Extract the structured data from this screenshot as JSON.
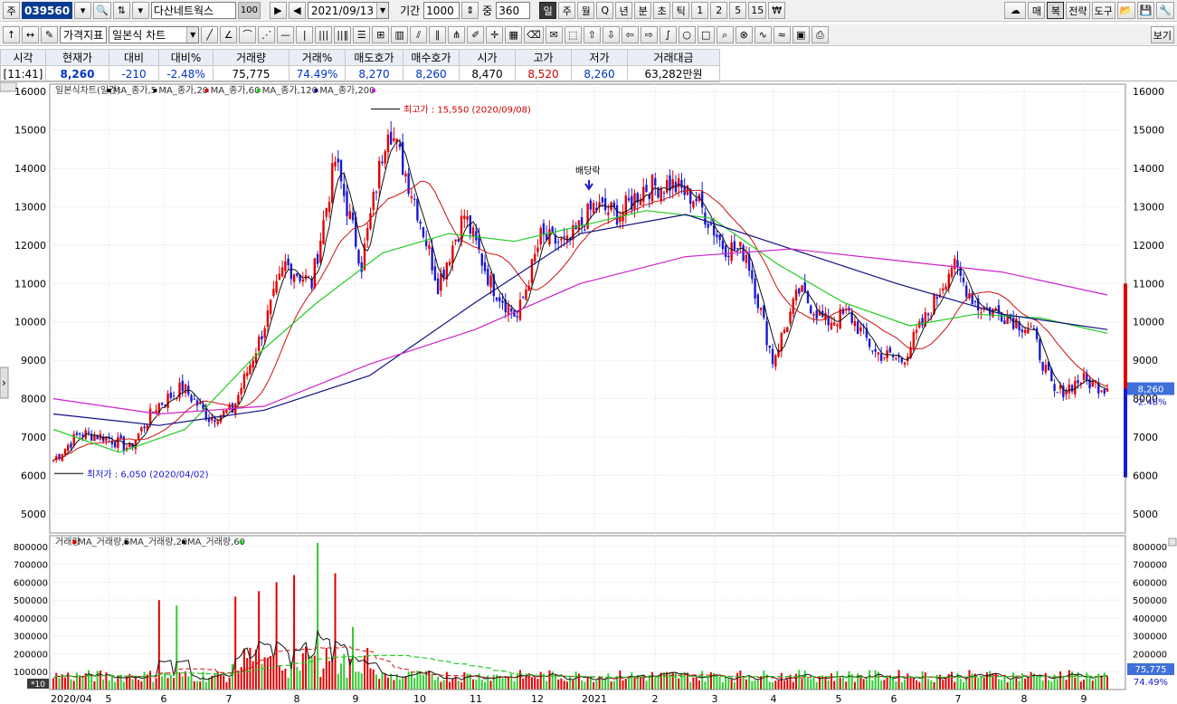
{
  "toolbar1": {
    "jong_label": "주",
    "code": "039560",
    "name": "다산네트웍스",
    "badge": "100",
    "date": "2021/09/13",
    "period_label": "기간",
    "period_value": "1000",
    "count_label": "중",
    "count_value": "360",
    "periods": [
      "일",
      "주",
      "월",
      "Q",
      "년",
      "분",
      "초",
      "틱",
      "1",
      "2",
      "5",
      "15",
      "₩"
    ],
    "right": [
      "매",
      "복",
      "전략",
      "도구"
    ]
  },
  "toolbar2": {
    "indicator_label": "가격지표",
    "chart_type": "일본식 차트",
    "view_label": "보기"
  },
  "quote": {
    "headers": [
      "시각",
      "현재가",
      "대비",
      "대비%",
      "거래량",
      "거래%",
      "매도호가",
      "매수호가",
      "시가",
      "고가",
      "저가",
      "거래대금"
    ],
    "time": "[11:41]",
    "price": "8,260",
    "change": "-210",
    "change_pct": "-2.48%",
    "volume": "75,775",
    "volume_pct": "74.49%",
    "ask": "8,270",
    "bid": "8,260",
    "open": "8,470",
    "high": "8,520",
    "low": "8,260",
    "amount": "63,282만원"
  },
  "price_legend": [
    "일본식차트(일간)",
    "MA_종가,5",
    "MA_종가,20",
    "MA_종가,60",
    "MA_종가,120",
    "MA_종가,200"
  ],
  "volume_legend": [
    "거래량",
    "MA_거래량,5",
    "MA_거래량,20",
    "MA_거래량,60"
  ],
  "annotations": {
    "max": "최고가 : 15,550 (2020/09/08)",
    "min": "최저가 : 6,050 (2020/04/02)",
    "dividend": "배당락",
    "price_tag": "8,260",
    "pct_tag": "-2.48%",
    "vol_tag": "75,775",
    "vol_pct_tag": "74.49%",
    "vol_unit": "*10"
  },
  "colors": {
    "up": "#e00000",
    "down": "#1a1ad0",
    "ma5": "#111111",
    "ma20": "#cc1111",
    "ma60": "#22cc22",
    "ma120": "#101080",
    "ma200": "#cc22cc"
  },
  "chart_data": [
    {
      "type": "candlestick",
      "title": "일본식차트(일간)",
      "ylim": [
        4500,
        16100
      ],
      "y_ticks": [
        5000,
        6000,
        7000,
        8000,
        9000,
        10000,
        11000,
        12000,
        13000,
        14000,
        15000,
        16000
      ],
      "x_ticks": [
        "2020/04",
        "5",
        "6",
        "7",
        "8",
        "9",
        "10",
        "11",
        "12",
        "2021",
        "2",
        "3",
        "4",
        "5",
        "6",
        "7",
        "8",
        "9"
      ],
      "close_path": [
        {
          "x": "2020/04",
          "close": 6400
        },
        {
          "x": "4 mid",
          "close": 7100
        },
        {
          "x": "5",
          "close": 7000
        },
        {
          "x": "5 mid",
          "close": 6700
        },
        {
          "x": "6",
          "close": 7800
        },
        {
          "x": "6 mid",
          "close": 8300
        },
        {
          "x": "6 late",
          "close": 7500
        },
        {
          "x": "7",
          "close": 7700
        },
        {
          "x": "7 mid",
          "close": 9500
        },
        {
          "x": "7 late",
          "close": 11500
        },
        {
          "x": "8",
          "close": 11000
        },
        {
          "x": "8 mid",
          "close": 14200
        },
        {
          "x": "8 late",
          "close": 11500
        },
        {
          "x": "9",
          "close": 15200
        },
        {
          "x": "9 mid",
          "close": 13200
        },
        {
          "x": "9 late",
          "close": 11000
        },
        {
          "x": "10",
          "close": 12800
        },
        {
          "x": "10 mid",
          "close": 11000
        },
        {
          "x": "10 late",
          "close": 10100
        },
        {
          "x": "11",
          "close": 12200
        },
        {
          "x": "11 mid",
          "close": 12000
        },
        {
          "x": "12",
          "close": 13000
        },
        {
          "x": "12 mid",
          "close": 12800
        },
        {
          "x": "12 late",
          "close": 13500
        },
        {
          "x": "2021",
          "close": 13600
        },
        {
          "x": "1 mid",
          "close": 13200
        },
        {
          "x": "2",
          "close": 12000
        },
        {
          "x": "2 mid",
          "close": 11800
        },
        {
          "x": "3",
          "close": 9000
        },
        {
          "x": "3 mid",
          "close": 10800
        },
        {
          "x": "4",
          "close": 10000
        },
        {
          "x": "4 mid",
          "close": 10200
        },
        {
          "x": "5",
          "close": 9200
        },
        {
          "x": "5 mid",
          "close": 9000
        },
        {
          "x": "6",
          "close": 10200
        },
        {
          "x": "6 mid",
          "close": 11500
        },
        {
          "x": "7",
          "close": 10400
        },
        {
          "x": "7 mid",
          "close": 10200
        },
        {
          "x": "8",
          "close": 9800
        },
        {
          "x": "8 mid",
          "close": 8100
        },
        {
          "x": "9",
          "close": 8500
        },
        {
          "x": "9 current",
          "close": 8260
        }
      ],
      "ma_values": {
        "MA_종가,60": [
          {
            "x": "2020/04",
            "v": 7200
          },
          {
            "x": "5",
            "v": 6600
          },
          {
            "x": "7",
            "v": 7200
          },
          {
            "x": "8",
            "v": 9000
          },
          {
            "x": "9",
            "v": 10500
          },
          {
            "x": "10",
            "v": 11800
          },
          {
            "x": "11",
            "v": 12300
          },
          {
            "x": "12",
            "v": 12100
          },
          {
            "x": "2021",
            "v": 12500
          },
          {
            "x": "2",
            "v": 12900
          },
          {
            "x": "3",
            "v": 12700
          },
          {
            "x": "4",
            "v": 11500
          },
          {
            "x": "5",
            "v": 10500
          },
          {
            "x": "6",
            "v": 9900
          },
          {
            "x": "7",
            "v": 10200
          },
          {
            "x": "8",
            "v": 10100
          },
          {
            "x": "9 current",
            "v": 9700
          }
        ],
        "MA_종가,120": [
          {
            "x": "2020/04",
            "v": 7600
          },
          {
            "x": "6",
            "v": 7300
          },
          {
            "x": "8",
            "v": 7700
          },
          {
            "x": "9",
            "v": 8600
          },
          {
            "x": "11",
            "v": 10500
          },
          {
            "x": "2021",
            "v": 12300
          },
          {
            "x": "2",
            "v": 12800
          },
          {
            "x": "4",
            "v": 11900
          },
          {
            "x": "6",
            "v": 11000
          },
          {
            "x": "8",
            "v": 10200
          },
          {
            "x": "9 current",
            "v": 9800
          }
        ],
        "MA_종가,200": [
          {
            "x": "2020/04",
            "v": 8000
          },
          {
            "x": "6",
            "v": 7600
          },
          {
            "x": "8",
            "v": 7800
          },
          {
            "x": "10",
            "v": 8900
          },
          {
            "x": "12",
            "v": 9800
          },
          {
            "x": "2",
            "v": 11000
          },
          {
            "x": "4",
            "v": 11700
          },
          {
            "x": "5",
            "v": 11900
          },
          {
            "x": "7",
            "v": 11600
          },
          {
            "x": "8",
            "v": 11300
          },
          {
            "x": "9 current",
            "v": 10700
          }
        ]
      }
    },
    {
      "type": "bar",
      "title": "거래량",
      "ylim": [
        0,
        850000
      ],
      "y_ticks": [
        0,
        100000,
        200000,
        300000,
        400000,
        500000,
        600000,
        700000,
        800000
      ],
      "y_tick_labels": [
        "100000",
        "200000",
        "300000",
        "400000",
        "500000",
        "600000",
        "700000",
        "800000"
      ],
      "spikes": [
        {
          "x": "5 late",
          "volume": 500000
        },
        {
          "x": "7",
          "volume": 520000
        },
        {
          "x": "7 mid",
          "volume": 550000
        },
        {
          "x": "7 late",
          "volume": 600000
        },
        {
          "x": "8",
          "volume": 640000
        },
        {
          "x": "8 mid",
          "volume": 820000
        },
        {
          "x": "8 late",
          "volume": 650000
        },
        {
          "x": "9",
          "volume": 350000
        },
        {
          "x": "6",
          "volume": 470000
        }
      ],
      "current_volume": 75775
    }
  ]
}
